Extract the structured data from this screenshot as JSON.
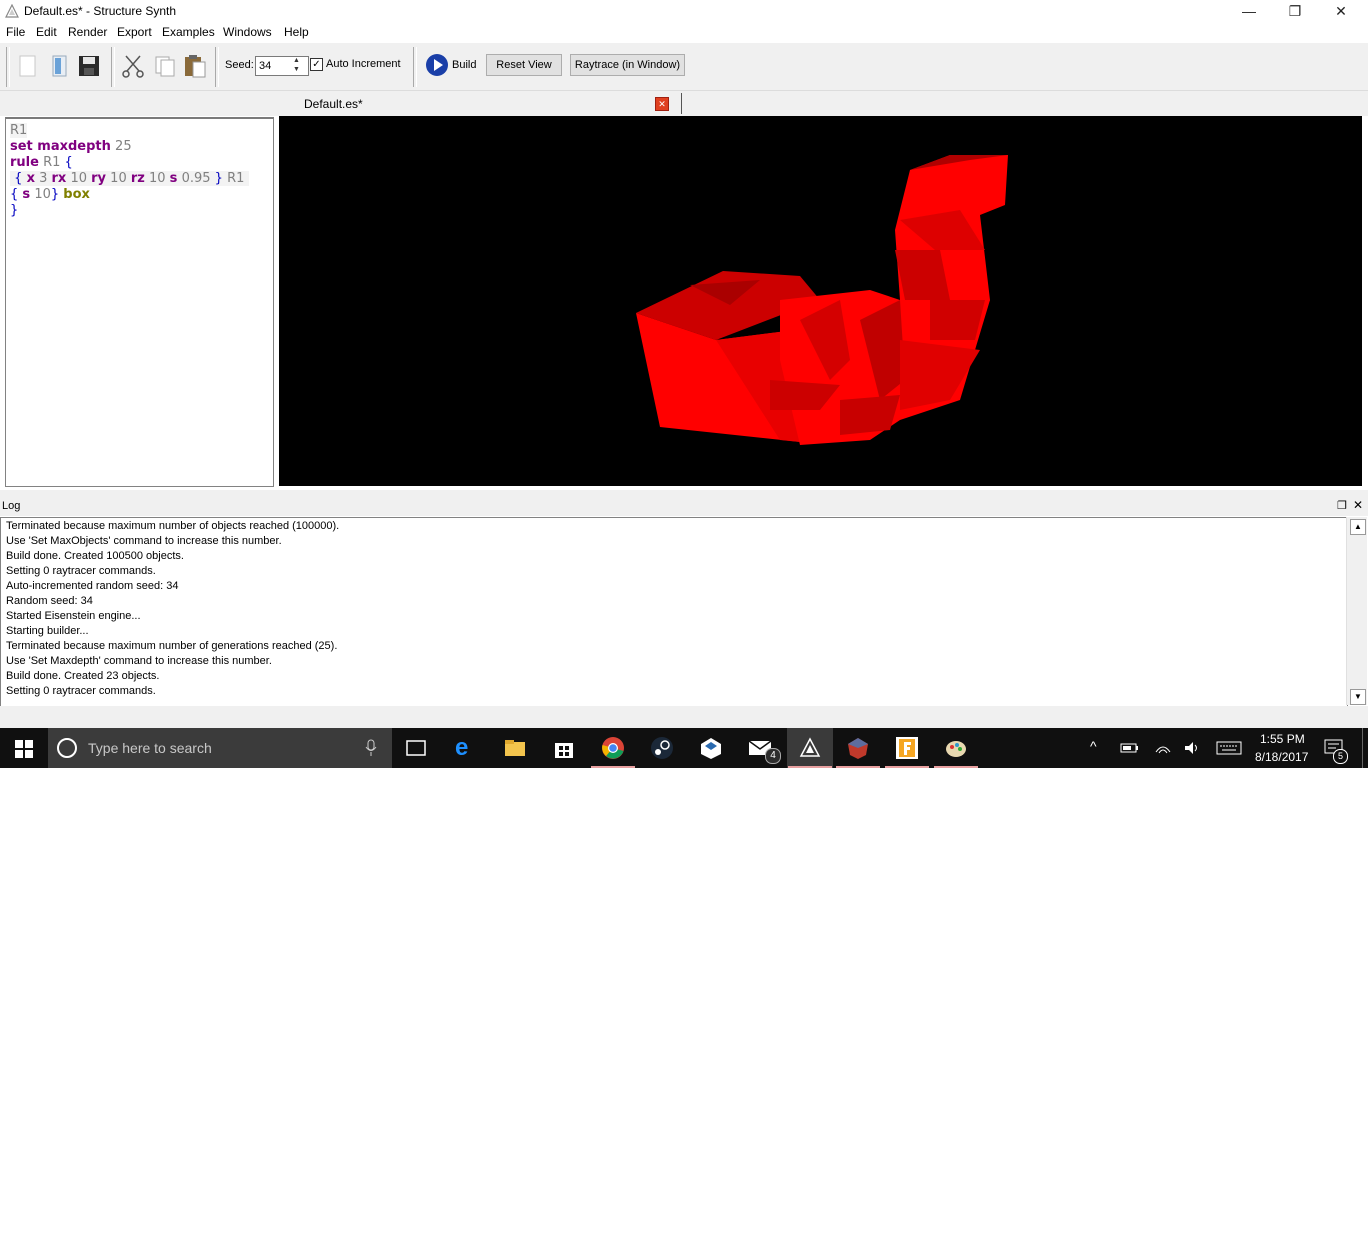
{
  "window": {
    "title": "Default.es* - Structure Synth",
    "minimize_glyph": "—",
    "restore_glyph": "❐",
    "close_glyph": "✕"
  },
  "menu": [
    "File",
    "Edit",
    "Render",
    "Export",
    "Examples",
    "Windows",
    "Help"
  ],
  "toolbar": {
    "seed_label": "Seed:",
    "seed_value": "34",
    "auto_increment_label": "Auto Increment",
    "auto_increment_checked": true,
    "build_label": "Build",
    "reset_view_label": "Reset View",
    "raytrace_label": "Raytrace (in Window)"
  },
  "editor": {
    "tab_title": "Default.es*",
    "code": {
      "line1": {
        "a": "R1"
      },
      "line2": {
        "kw": "set maxdepth",
        "num": "25"
      },
      "line3": {
        "kw": "rule",
        "ref": "R1",
        "br": "{"
      },
      "line4": {
        "b1": "{",
        "t1": "x",
        "n1": "3",
        "t2": "rx",
        "n2": "10",
        "t3": "ry",
        "n3": "10",
        "t4": "rz",
        "n4": "10",
        "t5": "s",
        "n5": "0.95",
        "b2": "}",
        "ref": "R1"
      },
      "line5": {
        "b1": "{",
        "t1": "s",
        "n1": "10",
        "b2": "}",
        "prim": "box"
      },
      "line6": {
        "b": "}"
      }
    }
  },
  "viewport": {
    "background": "#000000",
    "object_color": "#ff0000"
  },
  "log": {
    "title": "Log",
    "lines": [
      "Terminated because maximum number of objects reached (100000).",
      "Use 'Set MaxObjects' command to increase this number.",
      "Build done. Created 100500 objects.",
      "Setting 0 raytracer commands.",
      "Auto-incremented random seed: 34",
      "Random seed: 34",
      "Started Eisenstein engine...",
      "Starting builder...",
      "Terminated because maximum number of generations reached (25).",
      "Use 'Set Maxdepth' command to increase this number.",
      "Build done. Created 23 objects.",
      "Setting 0 raytracer commands."
    ]
  },
  "taskbar": {
    "search_placeholder": "Type here to search",
    "time": "1:55 PM",
    "date": "8/18/2017",
    "mail_badge": "4",
    "notification_badge": "5"
  }
}
